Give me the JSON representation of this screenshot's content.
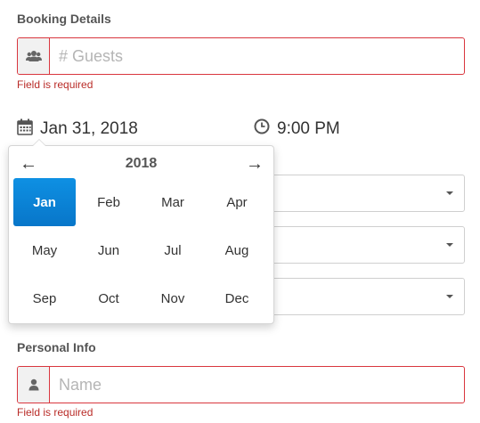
{
  "booking": {
    "title": "Booking Details",
    "guests_placeholder": "# Guests",
    "guests_error": "Field is required",
    "date_label": "Jan 31, 2018",
    "time_label": "9:00 PM"
  },
  "picker": {
    "year": "2018",
    "prev": "←",
    "next": "→",
    "months": [
      "Jan",
      "Feb",
      "Mar",
      "Apr",
      "May",
      "Jun",
      "Jul",
      "Aug",
      "Sep",
      "Oct",
      "Nov",
      "Dec"
    ],
    "selected_month": "Jan"
  },
  "personal": {
    "title": "Personal Info",
    "name_placeholder": "Name",
    "name_error": "Field is required"
  },
  "icons": {
    "guests": "users-icon",
    "calendar": "calendar-icon",
    "time": "clock-icon",
    "name": "user-icon"
  },
  "colors": {
    "error": "#d9363e",
    "accent": "#0876c9"
  }
}
